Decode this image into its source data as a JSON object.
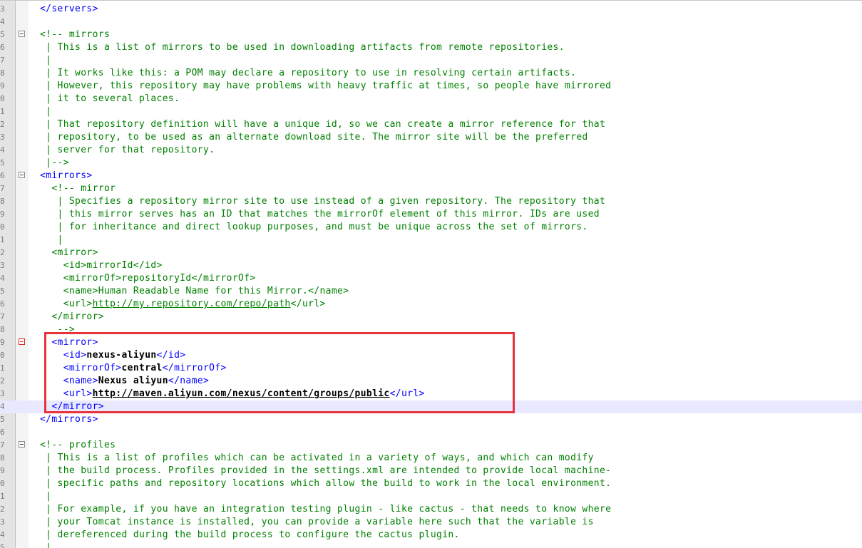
{
  "lines": [
    {
      "n": "3",
      "fold": null,
      "segs": [
        {
          "t": "</servers>",
          "s": "t"
        }
      ]
    },
    {
      "n": "4",
      "fold": null,
      "segs": []
    },
    {
      "n": "5",
      "fold": "minus",
      "segs": [
        {
          "t": "<!-- mirrors",
          "s": "c"
        }
      ]
    },
    {
      "n": "6",
      "fold": null,
      "segs": [
        {
          "t": " | This is a list of mirrors to be used in downloading artifacts from remote repositories.",
          "s": "c"
        }
      ]
    },
    {
      "n": "7",
      "fold": null,
      "segs": [
        {
          "t": " |",
          "s": "c"
        }
      ]
    },
    {
      "n": "8",
      "fold": null,
      "segs": [
        {
          "t": " | It works like this: a POM may declare a repository to use in resolving certain artifacts.",
          "s": "c"
        }
      ]
    },
    {
      "n": "9",
      "fold": null,
      "segs": [
        {
          "t": " | However, this repository may have problems with heavy traffic at times, so people have mirrored",
          "s": "c"
        }
      ]
    },
    {
      "n": "0",
      "fold": null,
      "segs": [
        {
          "t": " | it to several places.",
          "s": "c"
        }
      ]
    },
    {
      "n": "1",
      "fold": null,
      "segs": [
        {
          "t": " |",
          "s": "c"
        }
      ]
    },
    {
      "n": "2",
      "fold": null,
      "segs": [
        {
          "t": " | That repository definition will have a unique id, so we can create a mirror reference for that",
          "s": "c"
        }
      ]
    },
    {
      "n": "3",
      "fold": null,
      "segs": [
        {
          "t": " | repository, to be used as an alternate download site. The mirror site will be the preferred",
          "s": "c"
        }
      ]
    },
    {
      "n": "4",
      "fold": null,
      "segs": [
        {
          "t": " | server for that repository.",
          "s": "c"
        }
      ]
    },
    {
      "n": "5",
      "fold": null,
      "segs": [
        {
          "t": " |-->",
          "s": "c"
        }
      ]
    },
    {
      "n": "6",
      "fold": "minus",
      "segs": [
        {
          "t": "<mirrors>",
          "s": "t"
        }
      ]
    },
    {
      "n": "7",
      "fold": null,
      "segs": [
        {
          "t": "  <!-- mirror",
          "s": "c"
        }
      ]
    },
    {
      "n": "8",
      "fold": null,
      "segs": [
        {
          "t": "   | Specifies a repository mirror site to use instead of a given repository. The repository that",
          "s": "c"
        }
      ]
    },
    {
      "n": "9",
      "fold": null,
      "segs": [
        {
          "t": "   | this mirror serves has an ID that matches the mirrorOf element of this mirror. IDs are used",
          "s": "c"
        }
      ]
    },
    {
      "n": "0",
      "fold": null,
      "segs": [
        {
          "t": "   | for inheritance and direct lookup purposes, and must be unique across the set of mirrors.",
          "s": "c"
        }
      ]
    },
    {
      "n": "1",
      "fold": null,
      "segs": [
        {
          "t": "   |",
          "s": "c"
        }
      ]
    },
    {
      "n": "2",
      "fold": null,
      "segs": [
        {
          "t": "  <mirror>",
          "s": "c"
        }
      ]
    },
    {
      "n": "3",
      "fold": null,
      "segs": [
        {
          "t": "    <id>mirrorId</id>",
          "s": "c"
        }
      ]
    },
    {
      "n": "4",
      "fold": null,
      "segs": [
        {
          "t": "    <mirrorOf>repositoryId</mirrorOf>",
          "s": "c"
        }
      ]
    },
    {
      "n": "5",
      "fold": null,
      "segs": [
        {
          "t": "    <name>Human Readable Name for this Mirror.</name>",
          "s": "c"
        }
      ]
    },
    {
      "n": "6",
      "fold": null,
      "segs": [
        {
          "t": "    <url>",
          "s": "c"
        },
        {
          "t": "http://my.repository.com/repo/path",
          "s": "c u"
        },
        {
          "t": "</url>",
          "s": "c"
        }
      ]
    },
    {
      "n": "7",
      "fold": null,
      "segs": [
        {
          "t": "  </mirror>",
          "s": "c"
        }
      ]
    },
    {
      "n": "8",
      "fold": null,
      "segs": [
        {
          "t": "   -->",
          "s": "c"
        }
      ]
    },
    {
      "n": "9",
      "fold": "red",
      "segs": [
        {
          "t": "  <mirror>",
          "s": "t"
        }
      ]
    },
    {
      "n": "0",
      "fold": null,
      "segs": [
        {
          "t": "    <id>",
          "s": "t"
        },
        {
          "t": "nexus-aliyun",
          "s": "b"
        },
        {
          "t": "</id>",
          "s": "t"
        }
      ]
    },
    {
      "n": "1",
      "fold": null,
      "segs": [
        {
          "t": "    <mirrorOf>",
          "s": "t"
        },
        {
          "t": "central",
          "s": "b"
        },
        {
          "t": "</mirrorOf>",
          "s": "t"
        }
      ]
    },
    {
      "n": "2",
      "fold": null,
      "segs": [
        {
          "t": "    <name>",
          "s": "t"
        },
        {
          "t": "Nexus aliyun",
          "s": "b"
        },
        {
          "t": "</name>",
          "s": "t"
        }
      ]
    },
    {
      "n": "3",
      "fold": null,
      "segs": [
        {
          "t": "    <url>",
          "s": "t"
        },
        {
          "t": "http://maven.aliyun.com/nexus/content/groups/public",
          "s": "b u"
        },
        {
          "t": "</url>",
          "s": "t"
        }
      ]
    },
    {
      "n": "4",
      "fold": null,
      "current": true,
      "segs": [
        {
          "t": "  </mirror>",
          "s": "t"
        }
      ]
    },
    {
      "n": "5",
      "fold": null,
      "segs": [
        {
          "t": "</mirrors>",
          "s": "t"
        }
      ]
    },
    {
      "n": "6",
      "fold": null,
      "segs": []
    },
    {
      "n": "7",
      "fold": "minus",
      "segs": [
        {
          "t": "<!-- profiles",
          "s": "c"
        }
      ]
    },
    {
      "n": "8",
      "fold": null,
      "segs": [
        {
          "t": " | This is a list of profiles which can be activated in a variety of ways, and which can modify",
          "s": "c"
        }
      ]
    },
    {
      "n": "9",
      "fold": null,
      "segs": [
        {
          "t": " | the build process. Profiles provided in the settings.xml are intended to provide local machine-",
          "s": "c"
        }
      ]
    },
    {
      "n": "0",
      "fold": null,
      "segs": [
        {
          "t": " | specific paths and repository locations which allow the build to work in the local environment.",
          "s": "c"
        }
      ]
    },
    {
      "n": "1",
      "fold": null,
      "segs": [
        {
          "t": " |",
          "s": "c"
        }
      ]
    },
    {
      "n": "2",
      "fold": null,
      "segs": [
        {
          "t": " | For example, if you have an integration testing plugin - like cactus - that needs to know where",
          "s": "c"
        }
      ]
    },
    {
      "n": "3",
      "fold": null,
      "segs": [
        {
          "t": " | your Tomcat instance is installed, you can provide a variable here such that the variable is",
          "s": "c"
        }
      ]
    },
    {
      "n": "4",
      "fold": null,
      "segs": [
        {
          "t": " | dereferenced during the build process to configure the cactus plugin.",
          "s": "c"
        }
      ]
    },
    {
      "n": "5",
      "fold": null,
      "segs": [
        {
          "t": " |",
          "s": "c"
        }
      ]
    }
  ],
  "colors": {
    "comment": "#008000",
    "tag": "#0000ff",
    "highlight_box": "#e8323c",
    "current_line": "#e8e8ff"
  }
}
